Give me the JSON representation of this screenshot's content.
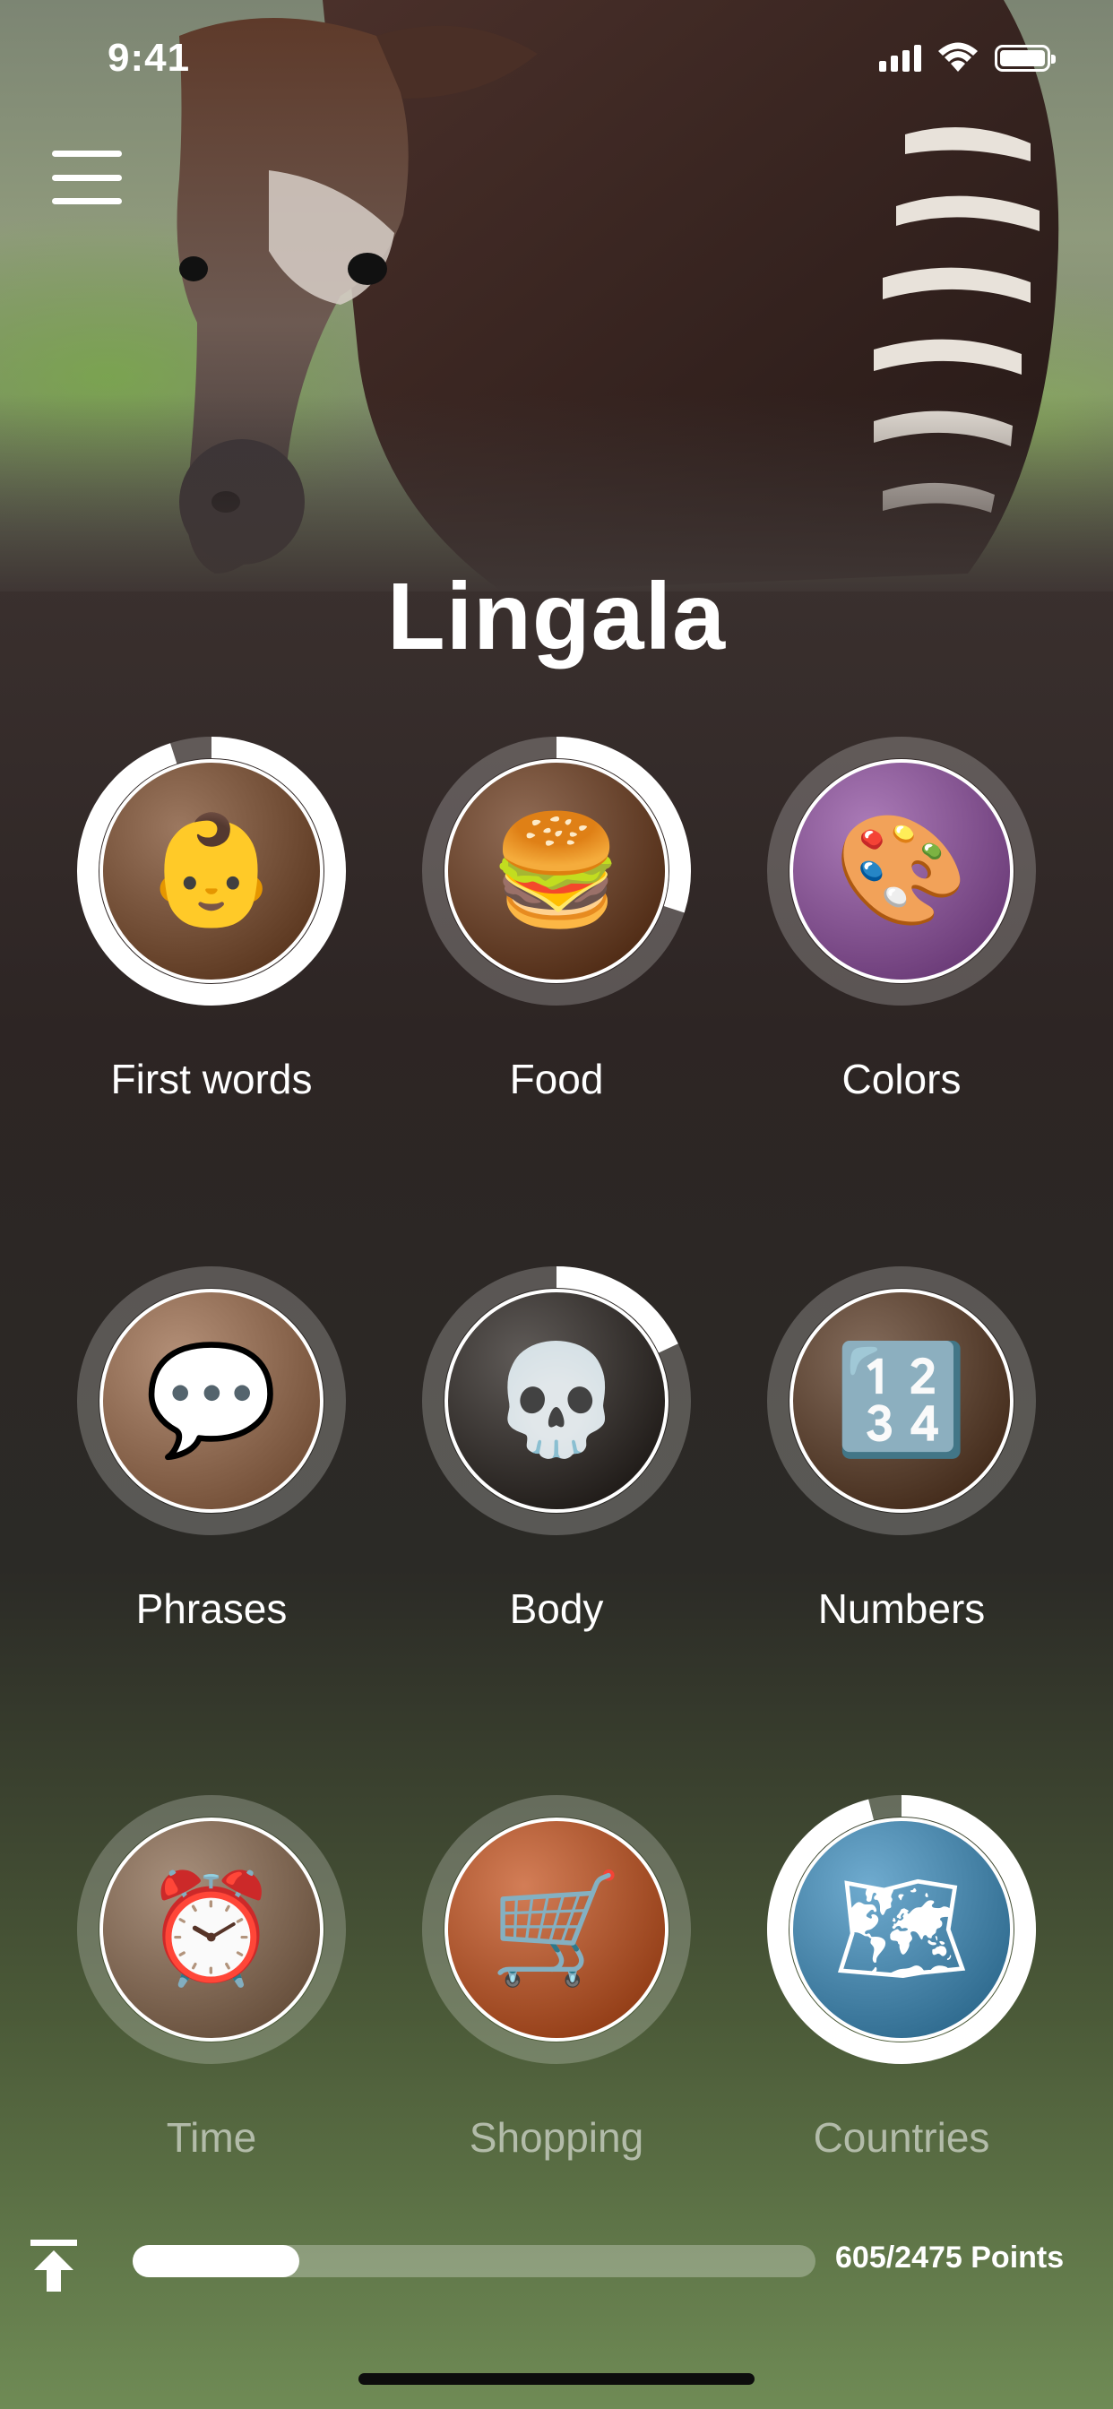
{
  "status_bar": {
    "time": "9:41"
  },
  "hero": {
    "animal": "okapi photo"
  },
  "title": "Lingala",
  "topics": [
    {
      "label": "First words",
      "progress": 0.95,
      "image": "baby-face",
      "icon": "👶",
      "bg": "#7a4a2a",
      "dimmed": false
    },
    {
      "label": "Food",
      "progress": 0.3,
      "image": "burger-meal",
      "icon": "🍔",
      "bg": "#6b3a1c",
      "dimmed": false
    },
    {
      "label": "Colors",
      "progress": 0.0,
      "image": "color-powder",
      "icon": "🎨",
      "bg": "#8f4fa0",
      "dimmed": false
    },
    {
      "label": "Phrases",
      "progress": 0.0,
      "image": "smiling-people",
      "icon": "💬",
      "bg": "#9a6a4a",
      "dimmed": false
    },
    {
      "label": "Body",
      "progress": 0.18,
      "image": "skeleton",
      "icon": "💀",
      "bg": "#2a2420",
      "dimmed": false
    },
    {
      "label": "Numbers",
      "progress": 0.0,
      "image": "wooden-numbers",
      "icon": "🔢",
      "bg": "#5a3a24",
      "dimmed": false
    },
    {
      "label": "Time",
      "progress": 0.0,
      "image": "alarm-clock",
      "icon": "⏰",
      "bg": "#8a6a50",
      "dimmed": true
    },
    {
      "label": "Shopping",
      "progress": 0.0,
      "image": "shopping-cart",
      "icon": "🛒",
      "bg": "#c4521e",
      "dimmed": true
    },
    {
      "label": "Countries",
      "progress": 0.96,
      "image": "world-map-pins",
      "icon": "🗺",
      "bg": "#3f8fbf",
      "dimmed": true
    }
  ],
  "progress": {
    "value": 0.244,
    "label": "605/2475 Points"
  }
}
